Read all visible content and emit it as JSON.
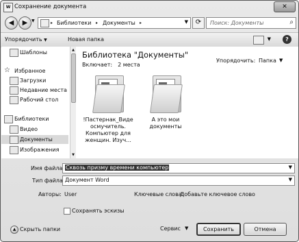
{
  "window": {
    "title": "Сохранение документа",
    "app_icon_text": "W",
    "close_label": "✕"
  },
  "nav": {
    "back_icon": "back-arrow",
    "forward_icon": "forward-arrow",
    "breadcrumbs": [
      "Библиотеки",
      "Документы"
    ],
    "search_placeholder": "Поиск: Документы"
  },
  "toolbar": {
    "organize": "Упорядочить",
    "new_folder": "Новая папка"
  },
  "sidebar": {
    "items": [
      {
        "label": "Шаблоны",
        "icon": "template-folder-icon",
        "group": false
      },
      {
        "label": "Избранное",
        "icon": "star-icon",
        "group": true
      },
      {
        "label": "Загрузки",
        "icon": "downloads-icon",
        "group": false
      },
      {
        "label": "Недавние места",
        "icon": "recent-places-icon",
        "group": false
      },
      {
        "label": "Рабочий стол",
        "icon": "desktop-icon",
        "group": false
      },
      {
        "label": "Библиотеки",
        "icon": "libraries-icon",
        "group": true
      },
      {
        "label": "Видео",
        "icon": "video-icon",
        "group": false
      },
      {
        "label": "Документы",
        "icon": "documents-icon",
        "group": false,
        "selected": true
      },
      {
        "label": "Изображения",
        "icon": "images-icon",
        "group": false
      }
    ]
  },
  "content": {
    "library_title": "Библиотека \"Документы\"",
    "includes_label": "Включает:",
    "includes_value": "2 места",
    "arrange_label": "Упорядочить:",
    "arrange_value": "Папка",
    "files": [
      {
        "name": "!Пастернак_Виде осмучитель. Компьютер для женщин. Изуч..."
      },
      {
        "name": "А это мои документы"
      }
    ]
  },
  "form": {
    "filename_label": "Имя файла:",
    "filename_value": "Сквозь призму времени компьютер",
    "filetype_label": "Тип файла:",
    "filetype_value": "Документ Word",
    "authors_label": "Авторы:",
    "authors_value": "User",
    "keywords_label": "Ключевые слова:",
    "keywords_value": "Добавьте ключевое слово",
    "thumbnails_label": "Сохранять эскизы",
    "thumbnails_checked": false
  },
  "footer": {
    "hide_folders": "Скрыть папки",
    "service": "Сервис",
    "save": "Сохранить",
    "cancel": "Отмена"
  }
}
